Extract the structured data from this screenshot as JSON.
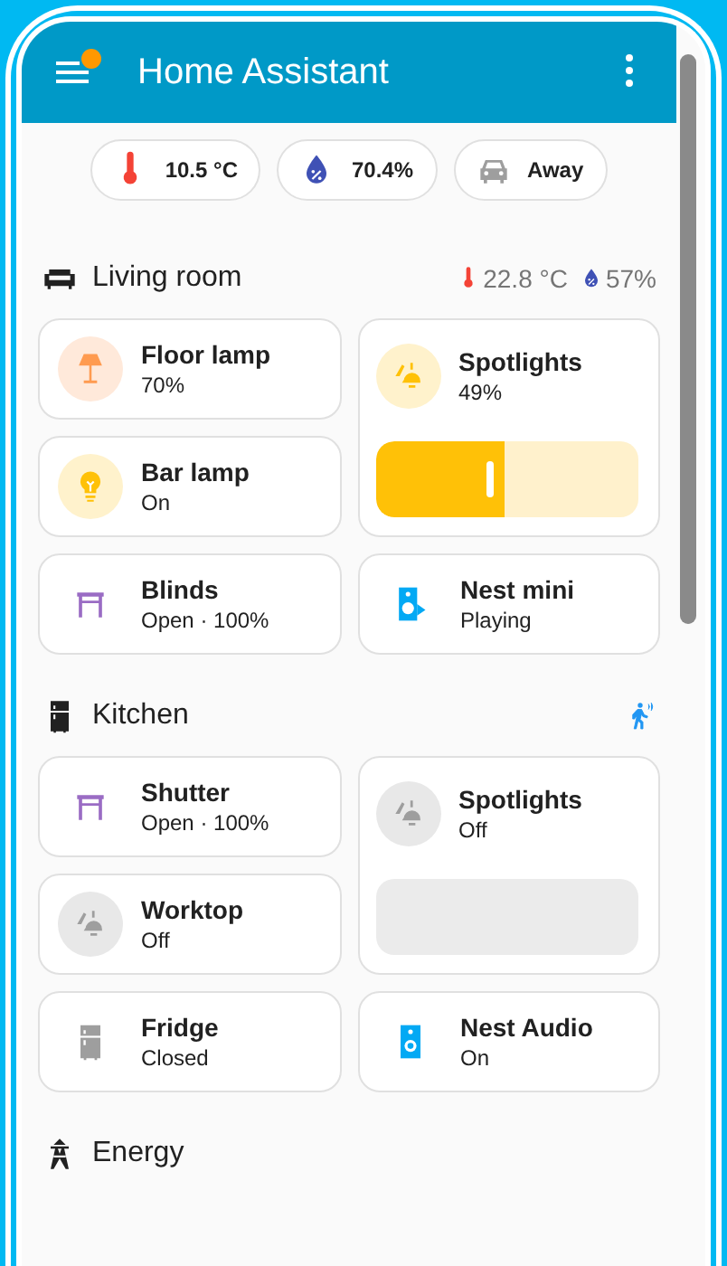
{
  "header": {
    "title": "Home Assistant",
    "notification": true
  },
  "badges": [
    {
      "kind": "temperature",
      "text": "10.5 °C"
    },
    {
      "kind": "humidity",
      "text": "70.4%"
    },
    {
      "kind": "car",
      "text": "Away"
    }
  ],
  "areas": [
    {
      "name": "Living room",
      "kind": "sofa",
      "sensors": [
        {
          "kind": "temperature",
          "text": "22.8 °C"
        },
        {
          "kind": "humidity",
          "text": "57%"
        }
      ],
      "cards": [
        {
          "kind": "floor_lamp",
          "name": "Floor lamp",
          "state": "70%",
          "on": true
        },
        {
          "kind": "spotlight",
          "name": "Spotlights",
          "state": "49%",
          "on": true,
          "slider": true,
          "level": 0.49
        },
        {
          "kind": "bulb",
          "name": "Bar lamp",
          "state": "On",
          "on": true
        },
        {
          "kind": "blinds",
          "name": "Blinds",
          "state": "Open · 100%",
          "on": true
        },
        {
          "kind": "speaker_play",
          "name": "Nest mini",
          "state": "Playing",
          "on": true
        }
      ]
    },
    {
      "name": "Kitchen",
      "kind": "fridge",
      "sensors": [
        {
          "kind": "motion"
        }
      ],
      "cards": [
        {
          "kind": "blinds",
          "name": "Shutter",
          "state": "Open · 100%",
          "on": true
        },
        {
          "kind": "spotlight",
          "name": "Spotlights",
          "state": "Off",
          "on": false,
          "slider": true
        },
        {
          "kind": "spotlight",
          "name": "Worktop",
          "state": "Off",
          "on": false
        },
        {
          "kind": "fridge",
          "name": "Fridge",
          "state": "Closed",
          "on": false
        },
        {
          "kind": "speaker",
          "name": "Nest Audio",
          "state": "On",
          "on": true
        }
      ]
    },
    {
      "name": "Energy",
      "kind": "pylon"
    }
  ]
}
